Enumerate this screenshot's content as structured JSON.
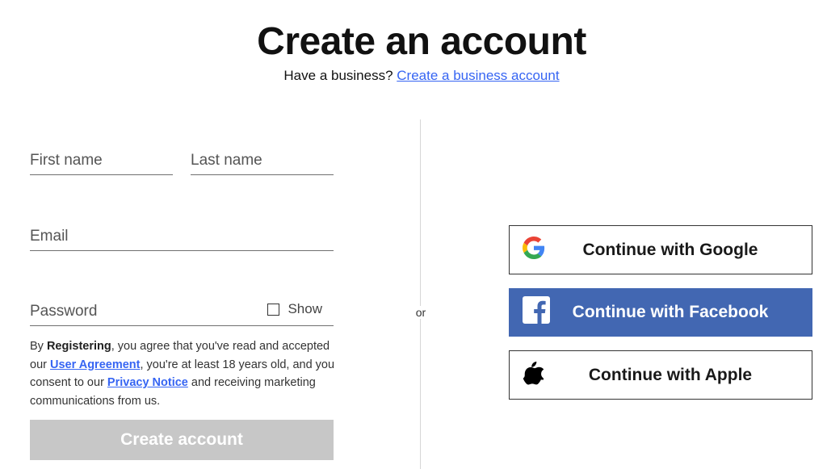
{
  "header": {
    "title": "Create an account",
    "business_prompt": "Have a business?",
    "business_link": "Create a business account"
  },
  "form": {
    "first_name_placeholder": "First name",
    "last_name_placeholder": "Last name",
    "email_placeholder": "Email",
    "password_placeholder": "Password",
    "show_label": "Show",
    "legal": {
      "prefix": "By ",
      "registering": "Registering",
      "part1": ", you agree that you've read and accepted our ",
      "user_agreement": "User Agreement",
      "part2": ", you're at least 18 years old, and you consent to our ",
      "privacy_notice": "Privacy Notice",
      "part3": " and receiving marketing communications from us."
    },
    "create_button": "Create account",
    "create_button_color": "#c7c7c7"
  },
  "divider": {
    "or_label": "or"
  },
  "social": [
    {
      "label": "Continue with Google",
      "icon": "google-icon"
    },
    {
      "label": "Continue with Facebook",
      "icon": "facebook-icon",
      "color": "#4267b2"
    },
    {
      "label": "Continue with Apple",
      "icon": "apple-icon"
    }
  ],
  "colors": {
    "link": "#3665f3",
    "facebook": "#4267b2"
  }
}
